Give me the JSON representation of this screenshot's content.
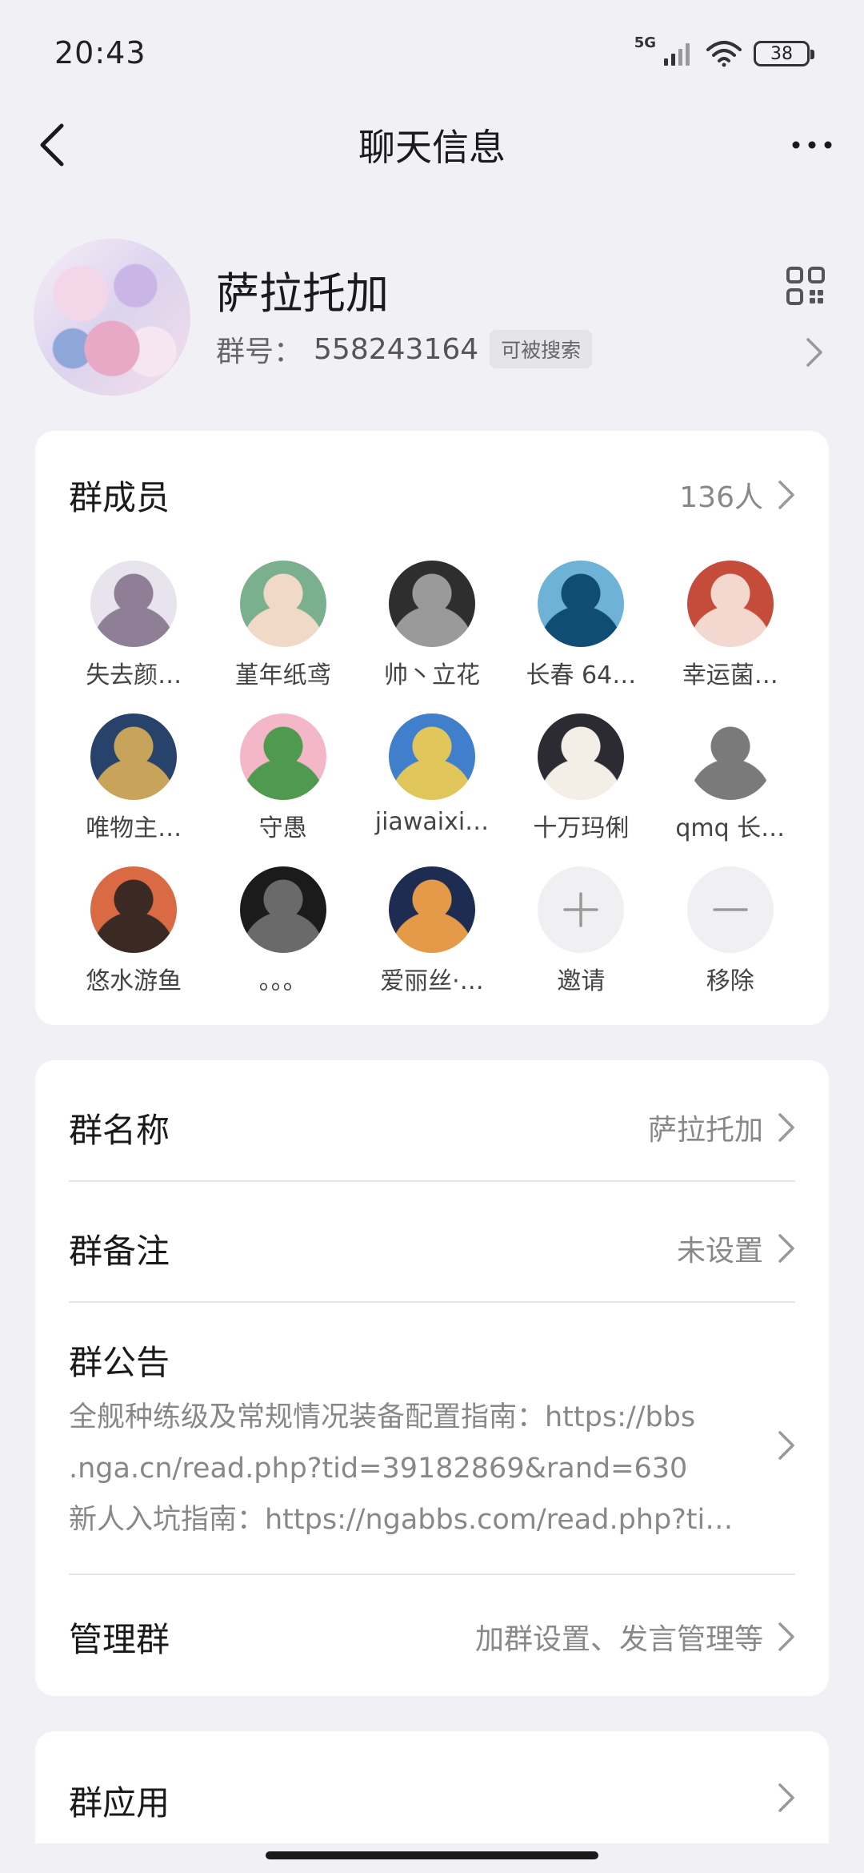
{
  "status_bar": {
    "time": "20:43",
    "network": "5G",
    "battery": "38"
  },
  "nav": {
    "title": "聊天信息"
  },
  "group": {
    "name": "萨拉托加",
    "id_label": "群号：",
    "id_value": "558243164",
    "searchable_badge": "可被搜索"
  },
  "members": {
    "title": "群成员",
    "count": "136人",
    "items": [
      {
        "name": "失去颜…",
        "color_a": "#e8e4ee",
        "color_b": "#8e7f96"
      },
      {
        "name": "堇年纸鸢",
        "color_a": "#7bb08f",
        "color_b": "#f1d9c8"
      },
      {
        "name": "帅丶立花",
        "color_a": "#2e2e2e",
        "color_b": "#9a9a9a"
      },
      {
        "name": "长春 64…",
        "color_a": "#6fb2d8",
        "color_b": "#0f4d74"
      },
      {
        "name": "幸运菌…",
        "color_a": "#c54b3a",
        "color_b": "#f2d8cf"
      },
      {
        "name": "唯物主…",
        "color_a": "#27426b",
        "color_b": "#c8a35a"
      },
      {
        "name": "守愚",
        "color_a": "#f3b7c8",
        "color_b": "#4f9a4f"
      },
      {
        "name": "jiawaixi…",
        "color_a": "#3f7fcc",
        "color_b": "#e1c65c"
      },
      {
        "name": "十万玛俐",
        "color_a": "#2c2a33",
        "color_b": "#f4efe6"
      },
      {
        "name": "qmq 长…",
        "color_a": "#ffffff",
        "color_b": "#7a7a7a"
      },
      {
        "name": "悠水游鱼",
        "color_a": "#d96a44",
        "color_b": "#3b2a24"
      },
      {
        "name": "。。。",
        "color_a": "#1b1b1b",
        "color_b": "#6a6a6a"
      },
      {
        "name": "爱丽丝·…",
        "color_a": "#1e2c52",
        "color_b": "#e59a4a"
      }
    ],
    "invite_label": "邀请",
    "remove_label": "移除"
  },
  "settings": {
    "group_name": {
      "label": "群名称",
      "value": "萨拉托加"
    },
    "group_remark": {
      "label": "群备注",
      "value": "未设置"
    },
    "notice": {
      "label": "群公告",
      "line1": "全舰种练级及常规情况装备配置指南：https://bbs",
      "line2": ".nga.cn/read.php?tid=39182869&rand=630",
      "line3": "新人入坑指南：https://ngabbs.com/read.php?ti…"
    },
    "manage": {
      "label": "管理群",
      "value": "加群设置、发言管理等"
    }
  },
  "apps": {
    "label": "群应用"
  }
}
